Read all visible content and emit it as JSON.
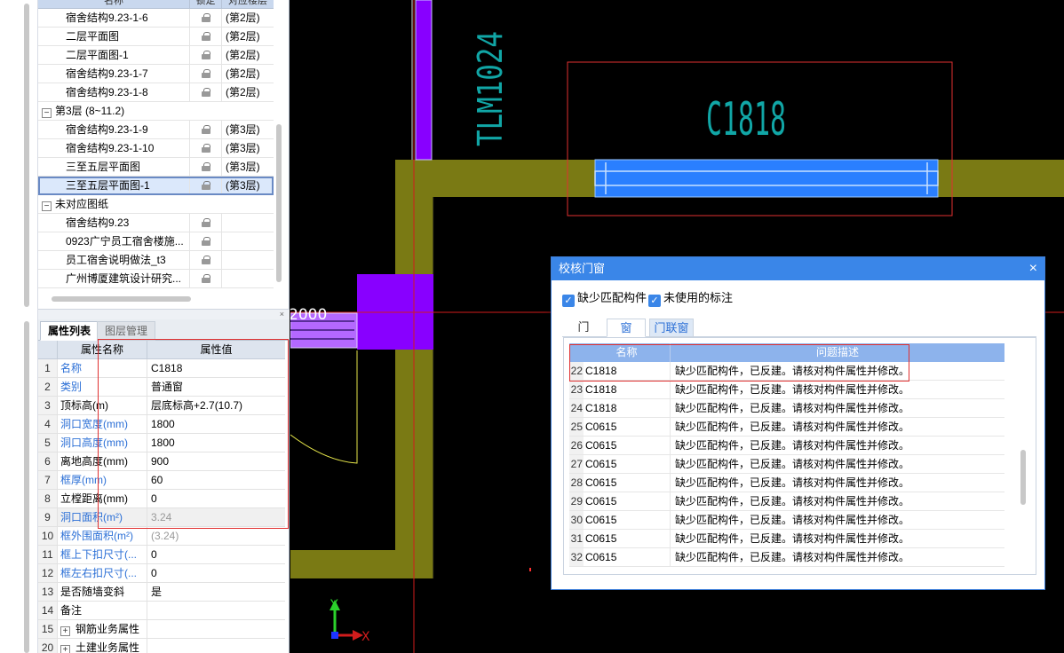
{
  "tree": {
    "headers": [
      "名称",
      "锁定",
      "对应楼层"
    ],
    "rows": [
      {
        "type": "leaf",
        "name": "宿舍结构9.23-1-6",
        "floor": "(第2层)"
      },
      {
        "type": "leaf",
        "name": "二层平面图",
        "floor": "(第2层)"
      },
      {
        "type": "leaf",
        "name": "二层平面图-1",
        "floor": "(第2层)"
      },
      {
        "type": "leaf",
        "name": "宿舍结构9.23-1-7",
        "floor": "(第2层)"
      },
      {
        "type": "leaf",
        "name": "宿舍结构9.23-1-8",
        "floor": "(第2层)"
      },
      {
        "type": "group",
        "name": "第3层 (8~11.2)",
        "expander": "−"
      },
      {
        "type": "leaf",
        "name": "宿舍结构9.23-1-9",
        "floor": "(第3层)"
      },
      {
        "type": "leaf",
        "name": "宿舍结构9.23-1-10",
        "floor": "(第3层)"
      },
      {
        "type": "leaf",
        "name": "三至五层平面图",
        "floor": "(第3层)"
      },
      {
        "type": "leaf",
        "name": "三至五层平面图-1",
        "floor": "(第3层)",
        "selected": true
      },
      {
        "type": "group",
        "name": "未对应图纸",
        "expander": "−"
      },
      {
        "type": "leaf",
        "name": "宿舍结构9.23",
        "floor": ""
      },
      {
        "type": "leaf",
        "name": "0923广宁员工宿舍楼施...",
        "floor": ""
      },
      {
        "type": "leaf",
        "name": "员工宿舍说明做法_t3",
        "floor": ""
      },
      {
        "type": "leaf",
        "name": "广州博厦建筑设计研究...",
        "floor": ""
      }
    ]
  },
  "panel": {
    "close_glyph": "×",
    "tabs": [
      "属性列表",
      "图层管理"
    ],
    "headers": [
      "属性名称",
      "属性值"
    ]
  },
  "properties": [
    {
      "num": "1",
      "key": "名称",
      "value": "C1818",
      "blue": true
    },
    {
      "num": "2",
      "key": "类别",
      "value": "普通窗",
      "blue": true
    },
    {
      "num": "3",
      "key": "顶标高(m)",
      "value": "层底标高+2.7(10.7)",
      "blue": false
    },
    {
      "num": "4",
      "key": "洞口宽度(mm)",
      "value": "1800",
      "blue": true
    },
    {
      "num": "5",
      "key": "洞口高度(mm)",
      "value": "1800",
      "blue": true
    },
    {
      "num": "6",
      "key": "离地高度(mm)",
      "value": "900",
      "blue": false
    },
    {
      "num": "7",
      "key": "框厚(mm)",
      "value": "60",
      "blue": true
    },
    {
      "num": "8",
      "key": "立樘距离(mm)",
      "value": "0",
      "blue": false
    },
    {
      "num": "9",
      "key": "洞口面积(m²)",
      "value": "3.24",
      "blue": true,
      "gray": true,
      "hl": true
    },
    {
      "num": "10",
      "key": "框外围面积(m²)",
      "value": "(3.24)",
      "blue": true,
      "gray": true
    },
    {
      "num": "11",
      "key": "框上下扣尺寸(...",
      "value": "0",
      "blue": true
    },
    {
      "num": "12",
      "key": "框左右扣尺寸(...",
      "value": "0",
      "blue": true
    },
    {
      "num": "13",
      "key": "是否随墙变斜",
      "value": "是",
      "blue": false
    },
    {
      "num": "14",
      "key": "备注",
      "value": "",
      "blue": false
    },
    {
      "num": "15",
      "key": "钢筋业务属性",
      "value": "",
      "blue": false,
      "expander": "+"
    },
    {
      "num": "20",
      "key": "土建业务属性",
      "value": "",
      "blue": false,
      "expander": "+"
    }
  ],
  "canvas": {
    "labels": {
      "door": "TLM1024",
      "window": "C1818",
      "dim": "2000",
      "axis_x": "X",
      "axis_y": "Y"
    },
    "colors": {
      "wall": "#7a7a14",
      "column": "#8800ff",
      "window": "#2a7fff",
      "selection": "#ff3030",
      "text": "#11a6a6",
      "axis": "#d11c1c"
    }
  },
  "dialog": {
    "title": "校核门窗",
    "close_glyph": "×",
    "check_missing": "缺少匹配构件",
    "check_unused": "未使用的标注",
    "check_glyph": "✓",
    "tabs": {
      "door": "门",
      "window": "窗",
      "combo": "门联窗"
    },
    "grid_headers": {
      "name": "名称",
      "desc": "问题描述"
    },
    "rows": [
      {
        "num": "22",
        "name": "C1818",
        "desc": "缺少匹配构件，已反建。请核对构件属性并修改。"
      },
      {
        "num": "23",
        "name": "C1818",
        "desc": "缺少匹配构件，已反建。请核对构件属性并修改。"
      },
      {
        "num": "24",
        "name": "C1818",
        "desc": "缺少匹配构件，已反建。请核对构件属性并修改。"
      },
      {
        "num": "25",
        "name": "C0615",
        "desc": "缺少匹配构件，已反建。请核对构件属性并修改。"
      },
      {
        "num": "26",
        "name": "C0615",
        "desc": "缺少匹配构件，已反建。请核对构件属性并修改。"
      },
      {
        "num": "27",
        "name": "C0615",
        "desc": "缺少匹配构件，已反建。请核对构件属性并修改。"
      },
      {
        "num": "28",
        "name": "C0615",
        "desc": "缺少匹配构件，已反建。请核对构件属性并修改。"
      },
      {
        "num": "29",
        "name": "C0615",
        "desc": "缺少匹配构件，已反建。请核对构件属性并修改。"
      },
      {
        "num": "30",
        "name": "C0615",
        "desc": "缺少匹配构件，已反建。请核对构件属性并修改。"
      },
      {
        "num": "31",
        "name": "C0615",
        "desc": "缺少匹配构件，已反建。请核对构件属性并修改。"
      },
      {
        "num": "32",
        "name": "C0615",
        "desc": "缺少匹配构件，已反建。请核对构件属性并修改。"
      }
    ]
  }
}
